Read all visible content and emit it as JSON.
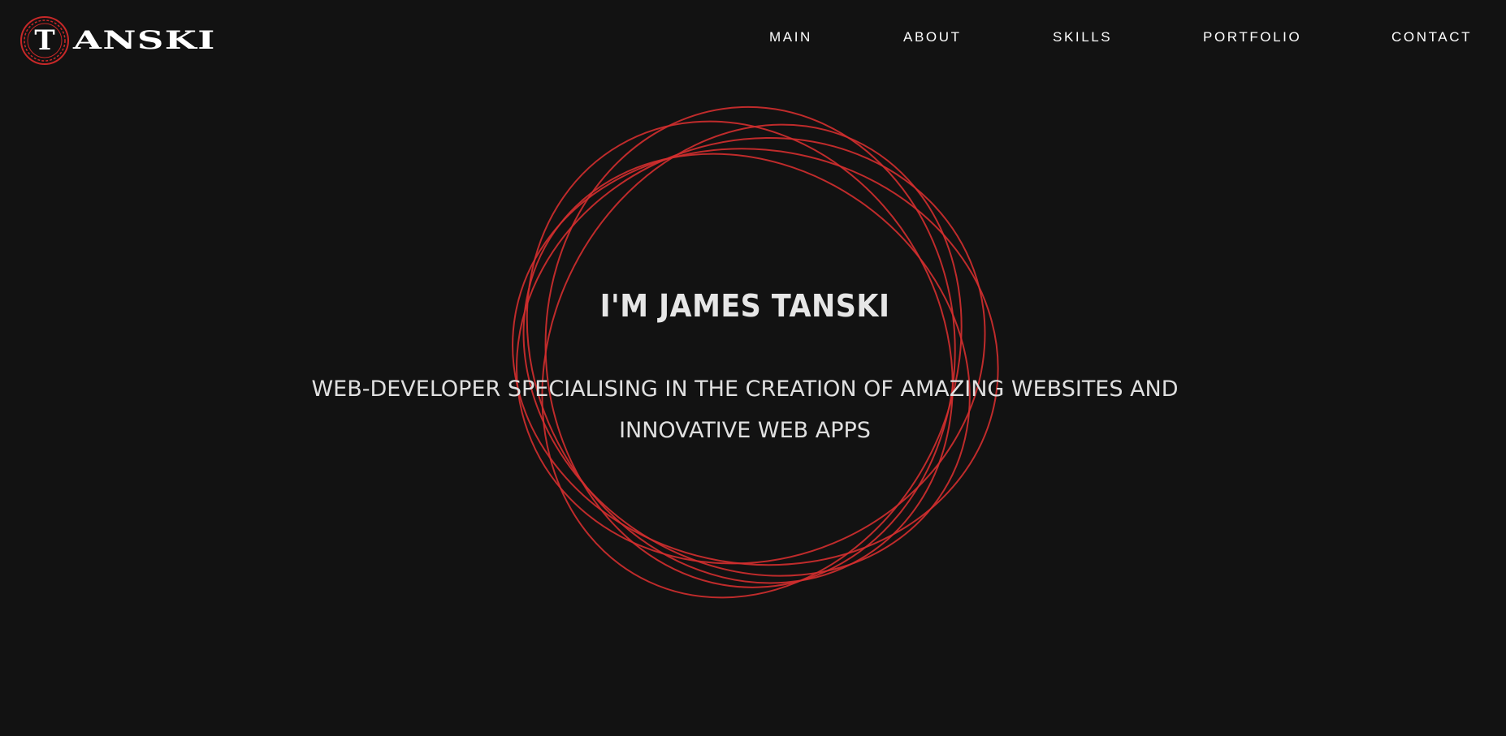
{
  "site": {
    "logo": {
      "initial": "T",
      "rest": "ANSKI",
      "ring_color": "#c62828"
    }
  },
  "nav": {
    "items": [
      {
        "label": "MAIN"
      },
      {
        "label": "ABOUT"
      },
      {
        "label": "SKILLS"
      },
      {
        "label": "PORTFOLIO"
      },
      {
        "label": "CONTACT"
      }
    ]
  },
  "hero": {
    "title": "I'M JAMES TANSKI",
    "subtitle": "WEB-DEVELOPER SPECIALISING IN THE CREATION OF AMAZING WEBSITES AND INNOVATIVE WEB APPS"
  },
  "theme": {
    "background": "#121212",
    "accent": "#d32f2f",
    "text": "#e6e6e6"
  }
}
